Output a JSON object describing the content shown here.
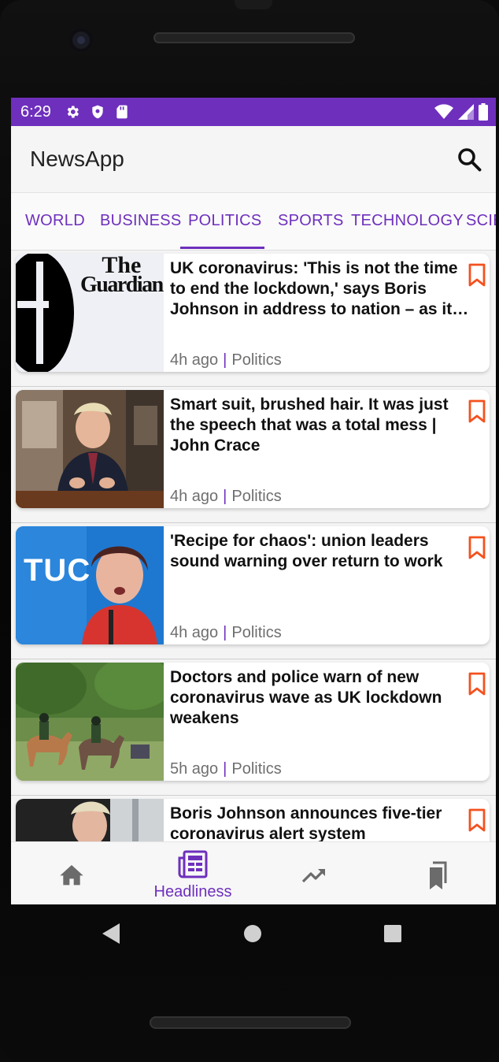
{
  "status_bar": {
    "time": "6:29"
  },
  "app": {
    "title": "NewsApp"
  },
  "tabs": [
    {
      "label": "WORLD"
    },
    {
      "label": "BUSINESS"
    },
    {
      "label": "POLITICS"
    },
    {
      "label": "SPORTS"
    },
    {
      "label": "TECHNOLOGY"
    },
    {
      "label": "SCIE"
    }
  ],
  "active_tab": "POLITICS",
  "articles": [
    {
      "headline": "UK coronavirus: 'This is not the time to end the lockdown,' says Boris Johnson in address to nation – as it…",
      "time": "4h ago",
      "category": "Politics",
      "thumb_logo_line1": "The",
      "thumb_logo_line2": "Guardian"
    },
    {
      "headline": "Smart suit, brushed hair. It was just the speech that was a total mess | John Crace",
      "time": "4h ago",
      "category": "Politics"
    },
    {
      "headline": "'Recipe for chaos': union leaders sound warning over return to work",
      "time": "4h ago",
      "category": "Politics",
      "thumb_text": "TUC"
    },
    {
      "headline": "Doctors and police warn of new coronavirus wave as UK lockdown weakens",
      "time": "5h ago",
      "category": "Politics"
    },
    {
      "headline": "Boris Johnson announces five-tier coronavirus alert system",
      "time": "",
      "category": ""
    }
  ],
  "bottom_nav": {
    "headlines_label": "Headliness"
  },
  "colors": {
    "accent": "#6e2fbd",
    "bookmark": "#f4511e"
  }
}
